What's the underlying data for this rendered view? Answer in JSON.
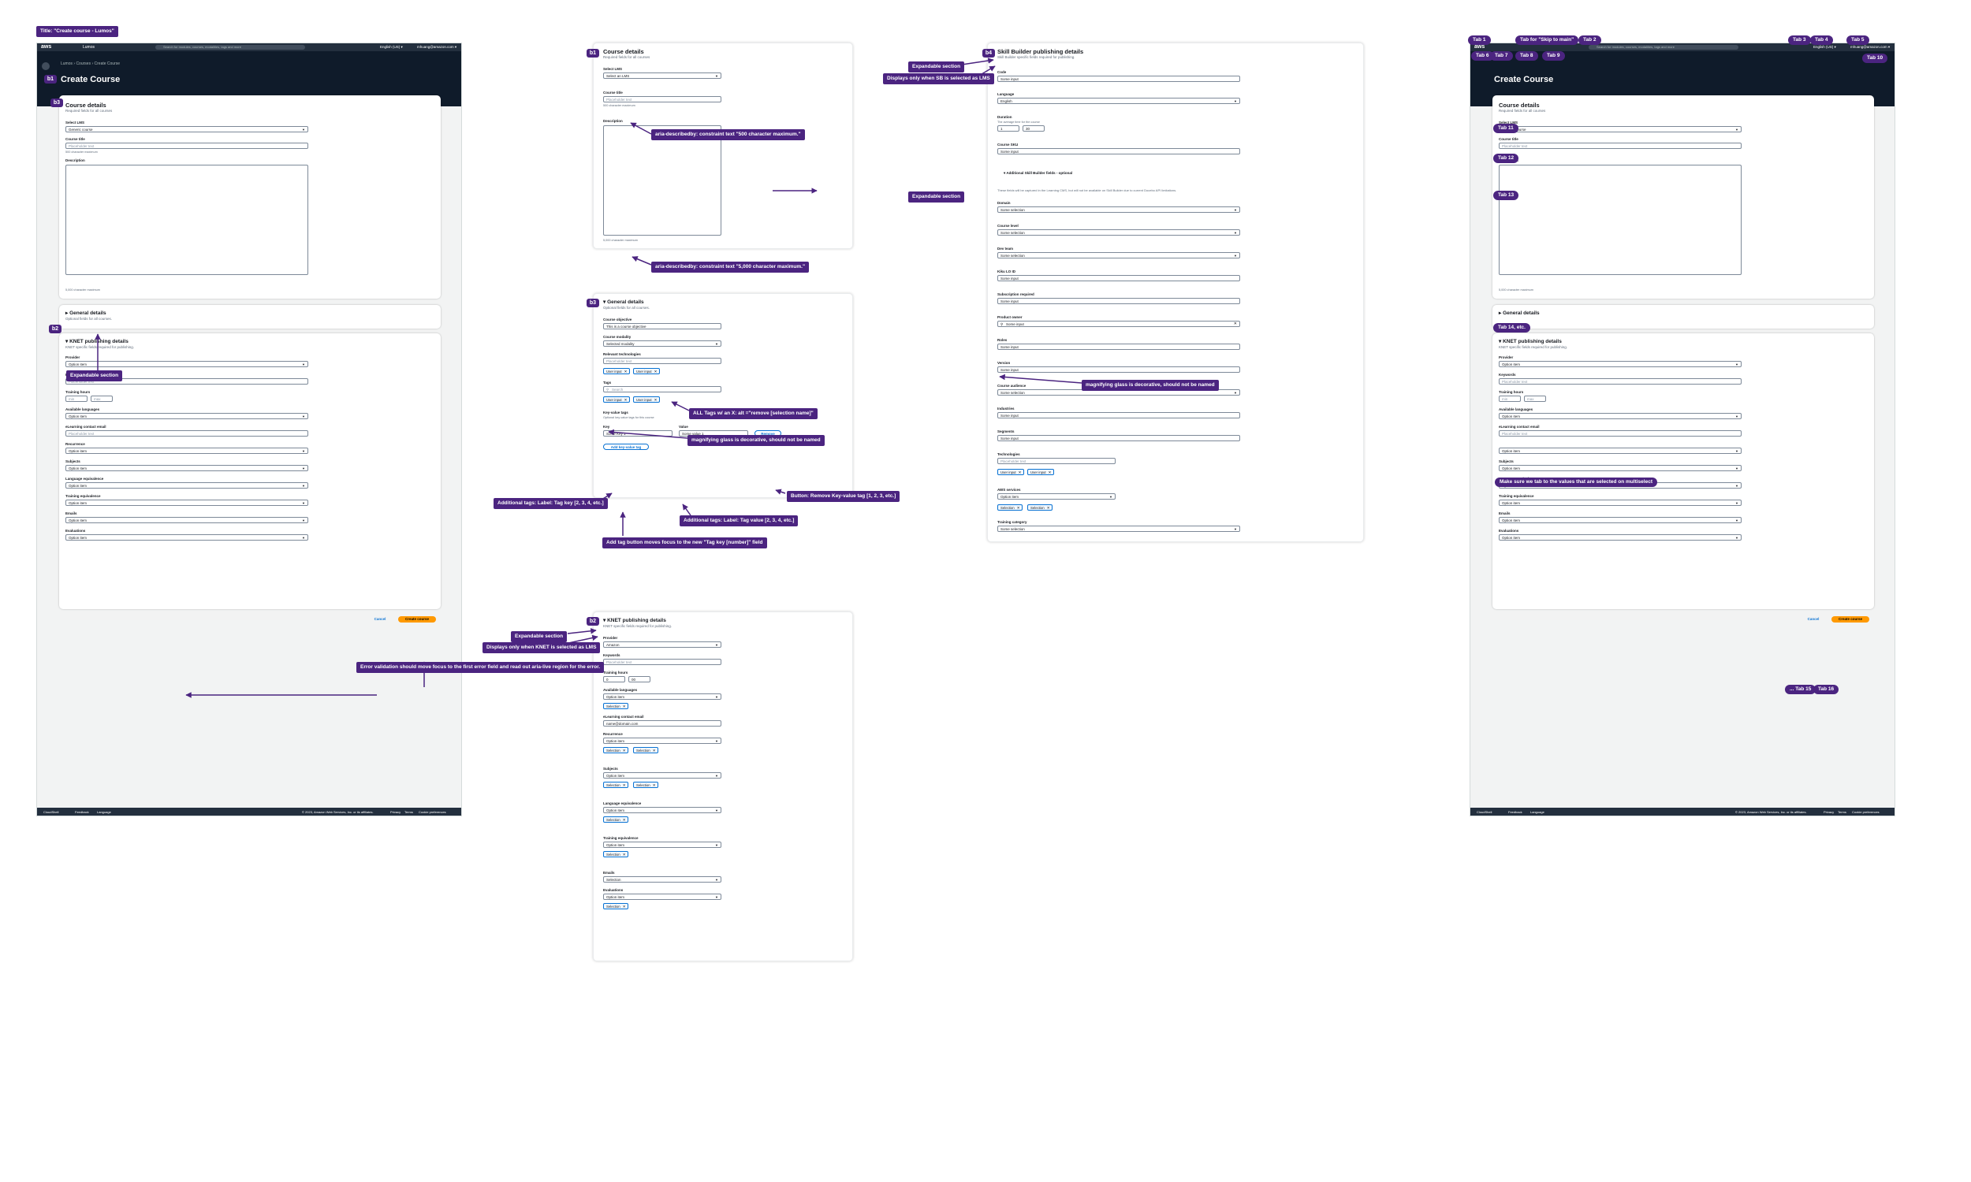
{
  "title_tag": "Title: \"Create course - Lumos\"",
  "nav": {
    "logo": "aws",
    "crumb": "Lumos",
    "search_placeholder": "Search for modules, courses, modalities, tags and more",
    "language": "English (US) ▾",
    "user": "mhuang@amazon.com ▾"
  },
  "breadcrumbs": "Lumos  ›  Courses  ›  Create Course",
  "page_title": "Create Course",
  "course_details": {
    "title": "Course details",
    "subtitle": "Required fields for all courses",
    "select_lms_label": "Select LMS",
    "select_lms_value": "Generic course",
    "select_lms_placeholder": "Select an LMS",
    "course_title_label": "Course title",
    "course_title_placeholder": "Placeholder text",
    "course_title_hint": "500 character maximum",
    "description_label": "Description",
    "description_hint": "5,000 character maximum"
  },
  "general_details": {
    "title": "▸ General details",
    "title_open": "▾ General details",
    "subtitle": "Optional fields for all courses.",
    "objective_label": "Course objective",
    "objective_value": "This is a course objective",
    "modality_label": "Course modality",
    "modality_value": "Selected modality",
    "tech_label": "Relevant technologies",
    "tech_placeholder": "Placeholder text",
    "user_input": "User input",
    "tags_label": "Tags",
    "tags_search": "Search",
    "kv_label": "Key-value tags",
    "kv_hint": "Optional key-value tags for this course",
    "key_label": "Key",
    "value_label": "Value",
    "key_value": "Some Key 1",
    "value_value": "Some value 1",
    "remove": "Remove",
    "add_tag": "Add key-value tag"
  },
  "knet": {
    "title": "▾ KNET publishing details",
    "subtitle": "KNET specific fields required for publishing.",
    "provider_label": "Provider",
    "provider_value": "Amazon",
    "option_item": "Option item",
    "keywords_label": "Keywords",
    "keywords_placeholder": "Placeholder text",
    "hours_label": "Training hours",
    "hours_h": "0",
    "hours_m": "00",
    "hours_h_ph": "min",
    "hours_m_ph": "max",
    "languages_label": "Available languages",
    "email_label": "eLearning contact email",
    "email_value": "name@domain.com",
    "email_placeholder": "Placeholder text",
    "recurrence_label": "Recurrence",
    "subjects_label": "Subjects",
    "lang_equiv_label": "Language equivalence",
    "training_equiv_label": "Training equivalence",
    "emails_label": "Emails",
    "evaluations_label": "Evaluations",
    "selection": "Selection"
  },
  "skill_builder": {
    "title": "Skill Builder publishing details",
    "subtitle": "Skill Builder specific fields required for publishing.",
    "code_label": "Code",
    "some_input": "Some input",
    "language_label": "Language",
    "language_value": "English",
    "duration_label": "Duration",
    "duration_hint": "The average time for the course",
    "duration_h": "1",
    "duration_m": "30",
    "sku_label": "Course SKU",
    "additional": "▾ Additional Skill Builder fields - optional",
    "note": "These fields will be captured in the Learning CMS, but will not be available on Skill Builder due to current Docebo API limitations.",
    "domain_label": "Domain",
    "some_selection": "Some selection",
    "level_label": "Course level",
    "devteam_label": "Dev team",
    "kiku_label": "Kiku LO ID",
    "subscription_label": "Subscription required",
    "product_owner_label": "Product owner",
    "roles_label": "Roles",
    "version_label": "Version",
    "audience_label": "Course audience",
    "industries_label": "Industries",
    "segments_label": "Segments",
    "technologies_label": "Technologies",
    "tech_placeholder": "Placeholder text",
    "user_input": "User input",
    "aws_services_label": "AWS services",
    "option_item": "Option item",
    "selection": "Selection",
    "training_category_label": "Training category"
  },
  "actions": {
    "cancel": "Cancel",
    "create": "Create course"
  },
  "footer": {
    "cloudshell": "CloudShell",
    "feedback": "Feedback",
    "language": "Language",
    "copyright": "© 2023, Amazon Web Services, Inc. or its affiliates.",
    "privacy": "Privacy",
    "terms": "Terms",
    "cookie": "Cookie preferences"
  },
  "step_badges": {
    "b1": "b1",
    "b2": "b2",
    "b3": "b3",
    "b4": "b4"
  },
  "annotations": {
    "expandable": "Expandable section",
    "sb_only": "Displays only when SB is selected as LMS",
    "knet_only": "Displays only when KNET is selected as LMS",
    "aria_500": "aria-describedby: constraint text \"500 character maximum.\"",
    "aria_5000": "aria-describedby: constraint text \"5,000 character maximum.\"",
    "all_tags": "ALL Tags w/ an X: alt =\"remove [selection name]\"",
    "magnify": "magnifying glass is decorative, should not be named",
    "magnify2": "magnifying glass is decorative, should not be named",
    "btn_remove": "Button: Remove Key-value tag [1, 2, 3, etc.]",
    "add_tags_key": "Additional tags: Label: Tag key [2, 3, 4, etc.]",
    "add_tags_value": "Additional tags: Label: Tag value [2, 3, 4, etc.]",
    "add_tag_focus": "Add tag button moves focus to the new \"Tag key [number]\" field",
    "error_validation": "Error validation should move focus to the first error field and read out aria-live region for the error.",
    "multiselect": "Make sure we tab to the values that are selected on multiselect"
  },
  "tabs": {
    "t1": "Tab 1",
    "skip": "Tab for \"Skip to main\"",
    "t2": "Tab 2",
    "t3": "Tab 3",
    "t4": "Tab 4",
    "t5": "Tab 5",
    "t6": "Tab 6",
    "t7": "Tab 7",
    "t8": "Tab 8",
    "t9": "Tab 9",
    "t10": "Tab 10",
    "t11": "Tab 11",
    "t12": "Tab 12",
    "t13": "Tab 13",
    "t14": "Tab 14, etc.",
    "t15": "... Tab 15",
    "t16": "Tab 16"
  }
}
